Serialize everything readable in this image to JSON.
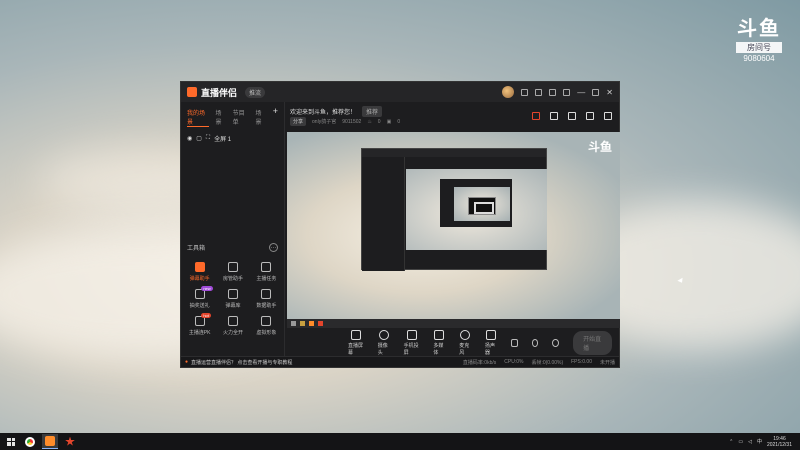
{
  "watermark": {
    "logo": "斗鱼",
    "tag": "房间号",
    "room": "9080604"
  },
  "app": {
    "name": "直播伴侣",
    "version": "推流"
  },
  "sidebar": {
    "tabs": [
      "我的场景",
      "场景",
      "节目单",
      "场景"
    ],
    "scene": "全屏 1",
    "tools_title": "工具箱",
    "tools": [
      {
        "label": "弹幕助手",
        "hot": true,
        "badge": ""
      },
      {
        "label": "房管助手",
        "hot": false,
        "badge": ""
      },
      {
        "label": "主播任务",
        "hot": false,
        "badge": ""
      },
      {
        "label": "抽奖送礼",
        "hot": false,
        "badge": "new"
      },
      {
        "label": "弹幕库",
        "hot": false,
        "badge": ""
      },
      {
        "label": "数据助手",
        "hot": false,
        "badge": ""
      },
      {
        "label": "主播连PK",
        "hot": false,
        "badge": "hot"
      },
      {
        "label": "火力全开",
        "hot": false,
        "badge": ""
      },
      {
        "label": "虚拟形象",
        "hot": false,
        "badge": ""
      }
    ]
  },
  "main": {
    "welcome": "欢迎来到斗鱼，推荐您！",
    "welcome_btn": "推荐",
    "meta": {
      "chip": "分享",
      "name": "only鸽子官",
      "room": "9011502",
      "fans": "0",
      "hot": "0"
    }
  },
  "controls": [
    {
      "label": "直播屏幕",
      "round": false
    },
    {
      "label": "摄像头",
      "round": true
    },
    {
      "label": "手机投屏",
      "round": false
    },
    {
      "label": "多媒体",
      "round": false
    },
    {
      "label": "麦克风",
      "round": false
    },
    {
      "label": "扬声器",
      "round": false
    }
  ],
  "go_live": "开始直播",
  "statusbar": {
    "alert": "直播运营直播伴侣？ 点击查看开播与专职教程",
    "stats": [
      "直播码率:0kb/s",
      "CPU:0%",
      "丢帧:0(0.00%)",
      "FPS:0.00",
      "未开播"
    ]
  },
  "taskbar": {
    "time": "19:46",
    "date": "2021/12/31"
  }
}
